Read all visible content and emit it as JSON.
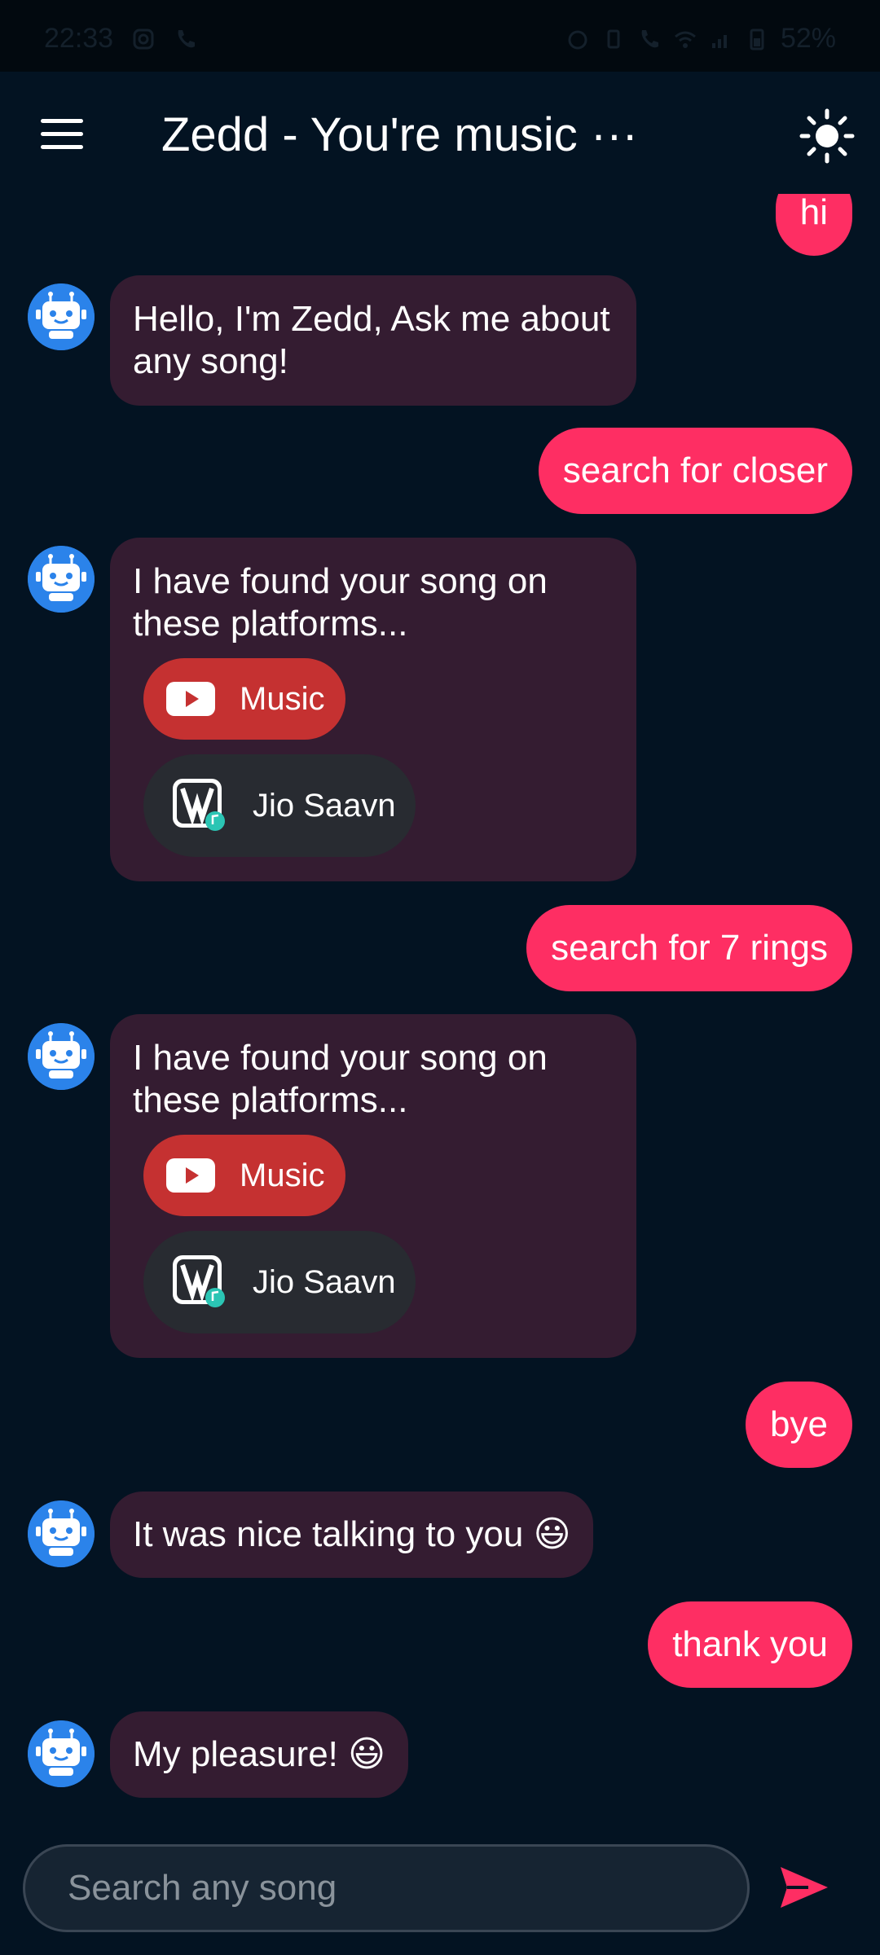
{
  "status_bar": {
    "time": "22:33",
    "battery": "52%"
  },
  "header": {
    "title": "Zedd - You're music ···"
  },
  "messages": {
    "m0": "hi",
    "m1": "Hello, I'm Zedd, Ask me about any song!",
    "m2": "search for closer",
    "m3": "I have found your song on these platforms...",
    "m4": "search for 7 rings",
    "m5": "I have found your song on these platforms...",
    "m6": "bye",
    "m7": "It was nice talking to you 😃",
    "m8": "thank you",
    "m9": "My pleasure! 😃"
  },
  "platforms": {
    "youtube": "Music",
    "jiosaavn": "Jio Saavn"
  },
  "input": {
    "placeholder": "Search any song",
    "value": ""
  },
  "icons": {
    "menu": "hamburger-menu-icon",
    "theme": "sun-icon",
    "avatar": "robot-icon",
    "youtube": "youtube-icon",
    "jiosaavn": "jiosaavn-icon",
    "send": "send-icon"
  },
  "colors": {
    "background": "#031322",
    "user_bubble": "#fe2e63",
    "bot_bubble": "#341c31",
    "youtube": "#c53131",
    "jiosaavn_button": "#282b31",
    "accent": "#fe2e63"
  }
}
